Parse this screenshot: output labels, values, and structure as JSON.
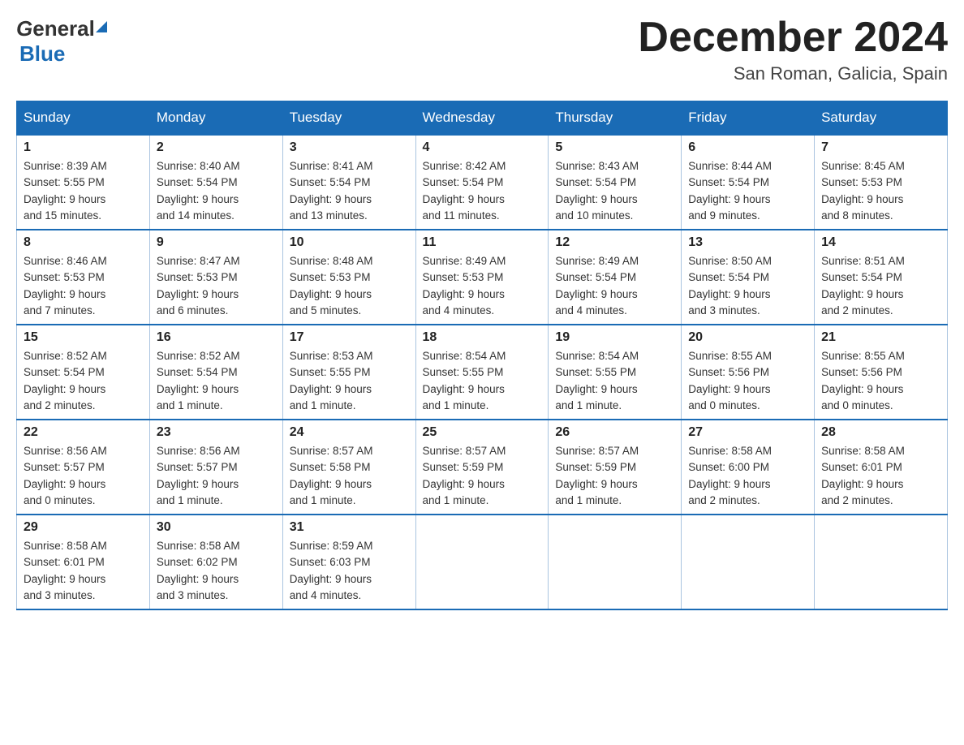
{
  "header": {
    "logo_text_black": "General",
    "logo_text_blue": "Blue",
    "month_title": "December 2024",
    "location": "San Roman, Galicia, Spain"
  },
  "days_of_week": [
    "Sunday",
    "Monday",
    "Tuesday",
    "Wednesday",
    "Thursday",
    "Friday",
    "Saturday"
  ],
  "weeks": [
    [
      {
        "day": "1",
        "sunrise": "8:39 AM",
        "sunset": "5:55 PM",
        "daylight": "9 hours and 15 minutes."
      },
      {
        "day": "2",
        "sunrise": "8:40 AM",
        "sunset": "5:54 PM",
        "daylight": "9 hours and 14 minutes."
      },
      {
        "day": "3",
        "sunrise": "8:41 AM",
        "sunset": "5:54 PM",
        "daylight": "9 hours and 13 minutes."
      },
      {
        "day": "4",
        "sunrise": "8:42 AM",
        "sunset": "5:54 PM",
        "daylight": "9 hours and 11 minutes."
      },
      {
        "day": "5",
        "sunrise": "8:43 AM",
        "sunset": "5:54 PM",
        "daylight": "9 hours and 10 minutes."
      },
      {
        "day": "6",
        "sunrise": "8:44 AM",
        "sunset": "5:54 PM",
        "daylight": "9 hours and 9 minutes."
      },
      {
        "day": "7",
        "sunrise": "8:45 AM",
        "sunset": "5:53 PM",
        "daylight": "9 hours and 8 minutes."
      }
    ],
    [
      {
        "day": "8",
        "sunrise": "8:46 AM",
        "sunset": "5:53 PM",
        "daylight": "9 hours and 7 minutes."
      },
      {
        "day": "9",
        "sunrise": "8:47 AM",
        "sunset": "5:53 PM",
        "daylight": "9 hours and 6 minutes."
      },
      {
        "day": "10",
        "sunrise": "8:48 AM",
        "sunset": "5:53 PM",
        "daylight": "9 hours and 5 minutes."
      },
      {
        "day": "11",
        "sunrise": "8:49 AM",
        "sunset": "5:53 PM",
        "daylight": "9 hours and 4 minutes."
      },
      {
        "day": "12",
        "sunrise": "8:49 AM",
        "sunset": "5:54 PM",
        "daylight": "9 hours and 4 minutes."
      },
      {
        "day": "13",
        "sunrise": "8:50 AM",
        "sunset": "5:54 PM",
        "daylight": "9 hours and 3 minutes."
      },
      {
        "day": "14",
        "sunrise": "8:51 AM",
        "sunset": "5:54 PM",
        "daylight": "9 hours and 2 minutes."
      }
    ],
    [
      {
        "day": "15",
        "sunrise": "8:52 AM",
        "sunset": "5:54 PM",
        "daylight": "9 hours and 2 minutes."
      },
      {
        "day": "16",
        "sunrise": "8:52 AM",
        "sunset": "5:54 PM",
        "daylight": "9 hours and 1 minute."
      },
      {
        "day": "17",
        "sunrise": "8:53 AM",
        "sunset": "5:55 PM",
        "daylight": "9 hours and 1 minute."
      },
      {
        "day": "18",
        "sunrise": "8:54 AM",
        "sunset": "5:55 PM",
        "daylight": "9 hours and 1 minute."
      },
      {
        "day": "19",
        "sunrise": "8:54 AM",
        "sunset": "5:55 PM",
        "daylight": "9 hours and 1 minute."
      },
      {
        "day": "20",
        "sunrise": "8:55 AM",
        "sunset": "5:56 PM",
        "daylight": "9 hours and 0 minutes."
      },
      {
        "day": "21",
        "sunrise": "8:55 AM",
        "sunset": "5:56 PM",
        "daylight": "9 hours and 0 minutes."
      }
    ],
    [
      {
        "day": "22",
        "sunrise": "8:56 AM",
        "sunset": "5:57 PM",
        "daylight": "9 hours and 0 minutes."
      },
      {
        "day": "23",
        "sunrise": "8:56 AM",
        "sunset": "5:57 PM",
        "daylight": "9 hours and 1 minute."
      },
      {
        "day": "24",
        "sunrise": "8:57 AM",
        "sunset": "5:58 PM",
        "daylight": "9 hours and 1 minute."
      },
      {
        "day": "25",
        "sunrise": "8:57 AM",
        "sunset": "5:59 PM",
        "daylight": "9 hours and 1 minute."
      },
      {
        "day": "26",
        "sunrise": "8:57 AM",
        "sunset": "5:59 PM",
        "daylight": "9 hours and 1 minute."
      },
      {
        "day": "27",
        "sunrise": "8:58 AM",
        "sunset": "6:00 PM",
        "daylight": "9 hours and 2 minutes."
      },
      {
        "day": "28",
        "sunrise": "8:58 AM",
        "sunset": "6:01 PM",
        "daylight": "9 hours and 2 minutes."
      }
    ],
    [
      {
        "day": "29",
        "sunrise": "8:58 AM",
        "sunset": "6:01 PM",
        "daylight": "9 hours and 3 minutes."
      },
      {
        "day": "30",
        "sunrise": "8:58 AM",
        "sunset": "6:02 PM",
        "daylight": "9 hours and 3 minutes."
      },
      {
        "day": "31",
        "sunrise": "8:59 AM",
        "sunset": "6:03 PM",
        "daylight": "9 hours and 4 minutes."
      },
      null,
      null,
      null,
      null
    ]
  ],
  "labels": {
    "sunrise": "Sunrise:",
    "sunset": "Sunset:",
    "daylight": "Daylight:"
  }
}
